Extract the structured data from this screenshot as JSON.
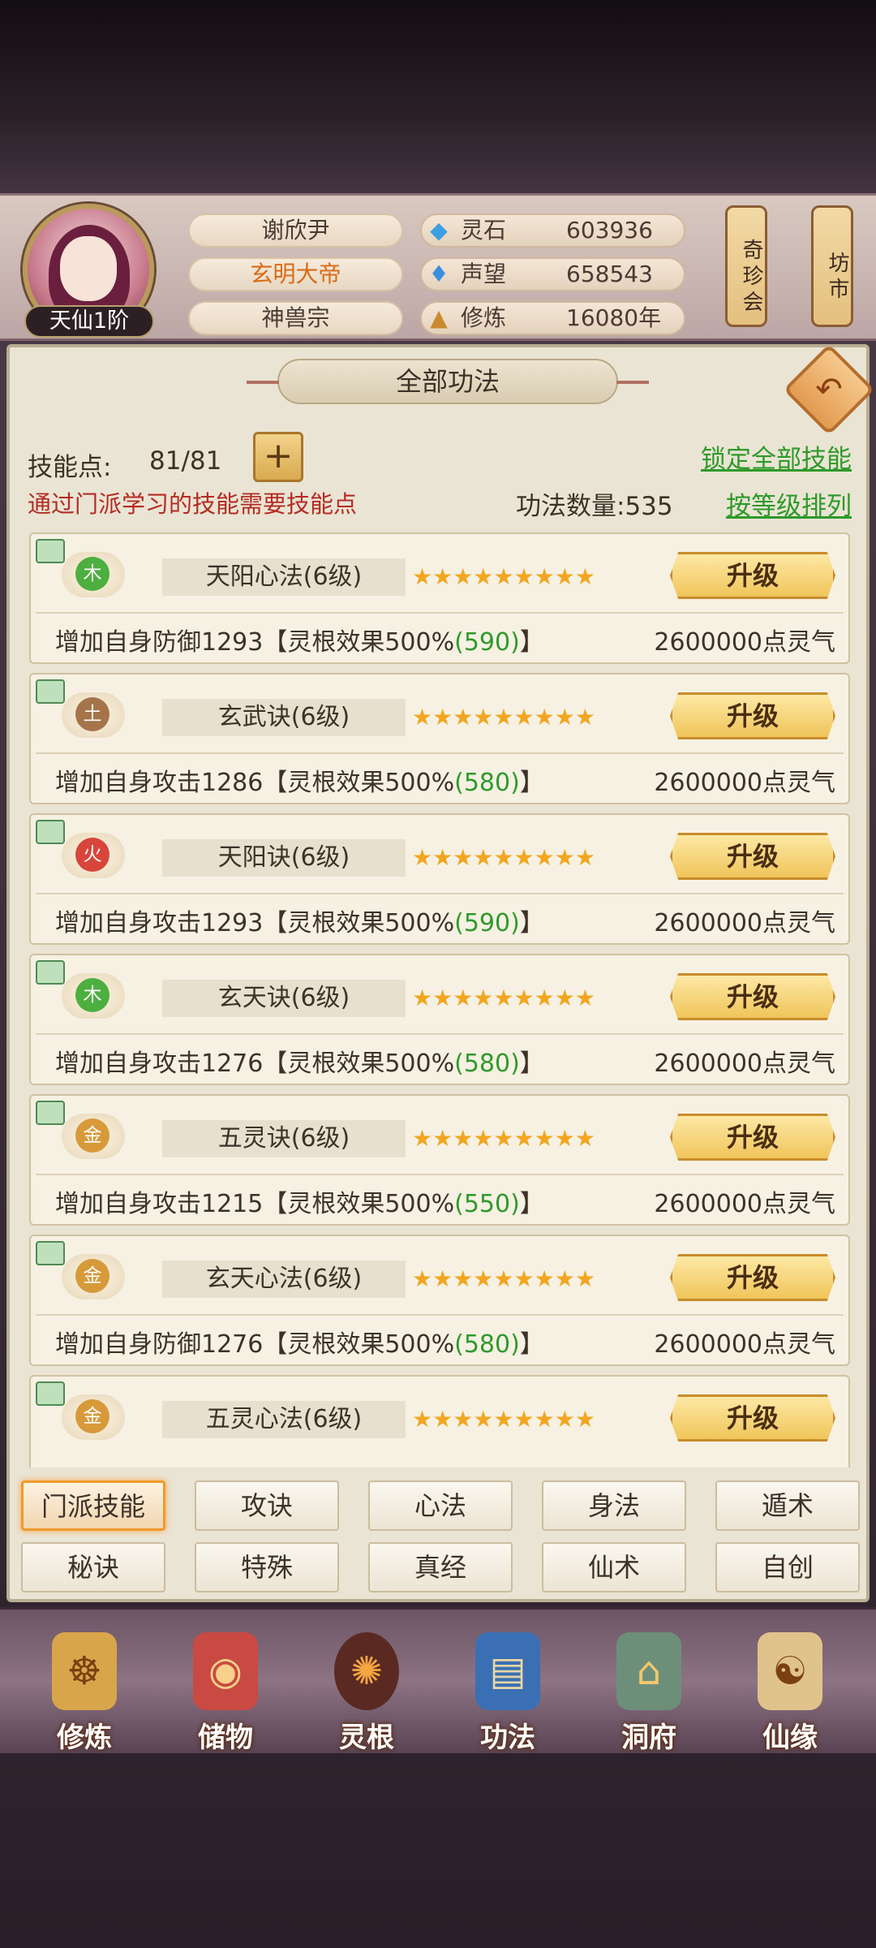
{
  "player": {
    "name": "谢欣尹",
    "title": "玄明大帝",
    "sect": "神兽宗",
    "tier": "天仙1阶"
  },
  "resources": [
    {
      "label": "灵石",
      "value": "603936",
      "icon": "spirit-stone-icon"
    },
    {
      "label": "声望",
      "value": "658543",
      "icon": "prestige-icon"
    },
    {
      "label": "修炼",
      "value": "16080年",
      "icon": "meditation-icon"
    }
  ],
  "lanterns": [
    {
      "label": "奇珍会"
    },
    {
      "label": "坊市"
    }
  ],
  "panel": {
    "title": "全部功法",
    "skill_points_label": "技能点:",
    "skill_points_value": "81/81",
    "skill_points_note": "通过门派学习的技能需要技能点",
    "lock_all": "锁定全部技能",
    "count_label": "功法数量:535",
    "sort_by_level": "按等级排列"
  },
  "skills": [
    {
      "element": "木",
      "name": "天阳心法(6级)",
      "stars": "★★★★★★★★★",
      "button": "升级",
      "desc_prefix": "增加自身防御1293【灵根效果500%",
      "desc_value": "(590)",
      "desc_suffix": "】",
      "cost": "2600000点灵气",
      "element_color": "#4caf3f"
    },
    {
      "element": "土",
      "name": "玄武诀(6级)",
      "stars": "★★★★★★★★★",
      "button": "升级",
      "desc_prefix": "增加自身攻击1286【灵根效果500%",
      "desc_value": "(580)",
      "desc_suffix": "】",
      "cost": "2600000点灵气",
      "element_color": "#a5744a"
    },
    {
      "element": "火",
      "name": "天阳诀(6级)",
      "stars": "★★★★★★★★★",
      "button": "升级",
      "desc_prefix": "增加自身攻击1293【灵根效果500%",
      "desc_value": "(590)",
      "desc_suffix": "】",
      "cost": "2600000点灵气",
      "element_color": "#d8453a"
    },
    {
      "element": "木",
      "name": "玄天诀(6级)",
      "stars": "★★★★★★★★★",
      "button": "升级",
      "desc_prefix": "增加自身攻击1276【灵根效果500%",
      "desc_value": "(580)",
      "desc_suffix": "】",
      "cost": "2600000点灵气",
      "element_color": "#4caf3f"
    },
    {
      "element": "金",
      "name": "五灵诀(6级)",
      "stars": "★★★★★★★★★",
      "button": "升级",
      "desc_prefix": "增加自身攻击1215【灵根效果500%",
      "desc_value": "(550)",
      "desc_suffix": "】",
      "cost": "2600000点灵气",
      "element_color": "#d79a3a"
    },
    {
      "element": "金",
      "name": "玄天心法(6级)",
      "stars": "★★★★★★★★★",
      "button": "升级",
      "desc_prefix": "增加自身防御1276【灵根效果500%",
      "desc_value": "(580)",
      "desc_suffix": "】",
      "cost": "2600000点灵气",
      "element_color": "#d79a3a"
    },
    {
      "element": "金",
      "name": "五灵心法(6级)",
      "stars": "★★★★★★★★★",
      "button": "升级",
      "desc_prefix": "",
      "desc_value": "",
      "desc_suffix": "",
      "cost": "",
      "element_color": "#d79a3a"
    }
  ],
  "categories": [
    [
      "门派技能",
      "攻诀",
      "心法",
      "身法",
      "遁术"
    ],
    [
      "秘诀",
      "特殊",
      "真经",
      "仙术",
      "自创"
    ]
  ],
  "active_category": "门派技能",
  "bottom_nav": [
    {
      "label": "修炼",
      "icon": "cultivate-icon"
    },
    {
      "label": "储物",
      "icon": "storage-bag-icon"
    },
    {
      "label": "灵根",
      "icon": "spirit-root-icon"
    },
    {
      "label": "功法",
      "icon": "skill-book-icon"
    },
    {
      "label": "洞府",
      "icon": "cave-dwelling-icon"
    },
    {
      "label": "仙缘",
      "icon": "immortal-fate-icon"
    }
  ]
}
